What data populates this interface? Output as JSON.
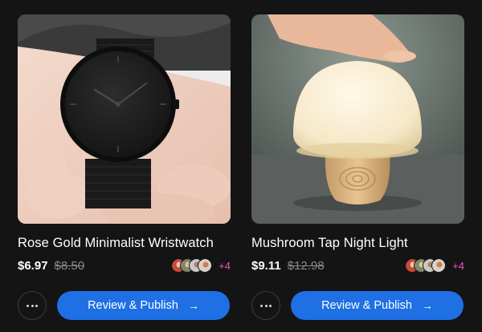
{
  "products": [
    {
      "title": "Rose Gold Minimalist Wristwatch",
      "price": "$6.97",
      "old_price": "$8.50",
      "extra_reviewers": "+4",
      "image_alt": "wristwatch-photo"
    },
    {
      "title": "Mushroom Tap Night Light",
      "price": "$9.11",
      "old_price": "$12.98",
      "extra_reviewers": "+4",
      "image_alt": "mushroom-lamp-photo"
    }
  ],
  "actions": {
    "publish_label": "Review & Publish",
    "arrow_icon": "arrow-right-icon",
    "more_icon": "more-horizontal-icon"
  },
  "colors": {
    "background": "#141414",
    "primary": "#1f6fe5",
    "accent_count": "#e457c2",
    "muted": "#8a8a8a"
  }
}
